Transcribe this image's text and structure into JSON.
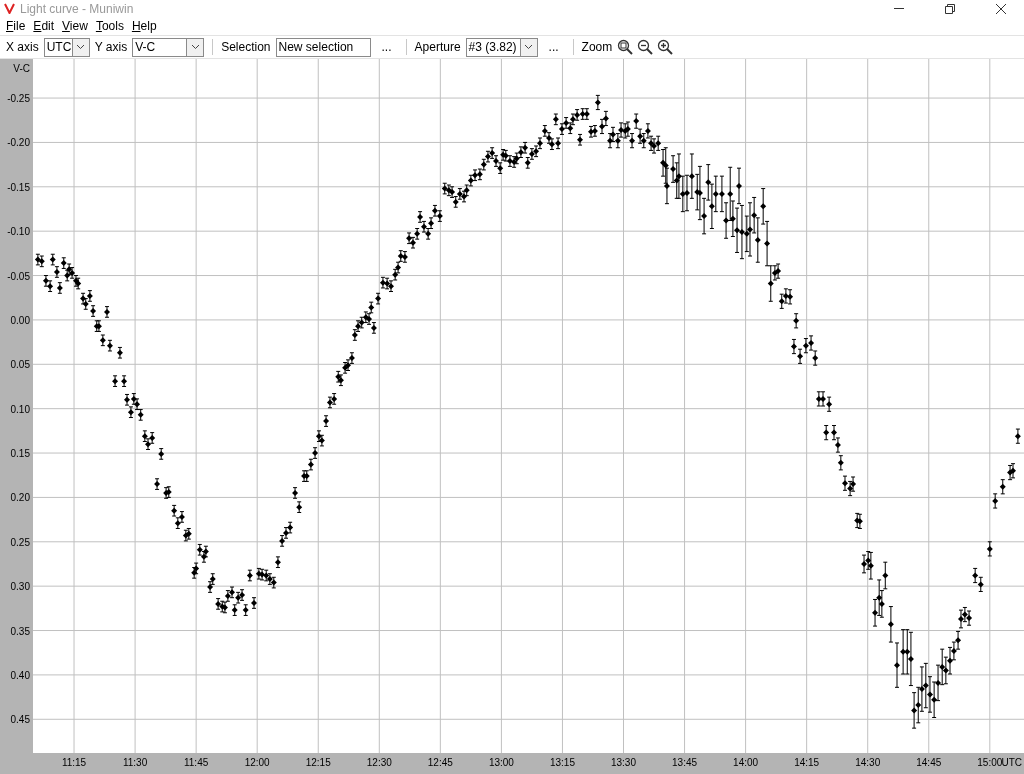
{
  "window": {
    "title": "Light curve - Muniwin"
  },
  "menu": [
    "File",
    "Edit",
    "View",
    "Tools",
    "Help"
  ],
  "toolbar": [
    {
      "kind": "label",
      "text": "X axis"
    },
    {
      "kind": "combo",
      "value": "UTC"
    },
    {
      "kind": "label",
      "text": "Y axis"
    },
    {
      "kind": "combo",
      "value": "V-C"
    },
    {
      "kind": "separator"
    },
    {
      "kind": "label",
      "text": "Selection"
    },
    {
      "kind": "field",
      "value": "New selection"
    },
    {
      "kind": "button",
      "text": "..."
    },
    {
      "kind": "separator"
    },
    {
      "kind": "label",
      "text": "Aperture"
    },
    {
      "kind": "combo",
      "value": "#3 (3.82)"
    },
    {
      "kind": "button",
      "text": "..."
    },
    {
      "kind": "separator"
    },
    {
      "kind": "label",
      "text": "Zoom"
    },
    {
      "kind": "zoom_icons"
    }
  ],
  "chart": {
    "chart_data": {
      "type": "scatter",
      "xlabel": "UTC",
      "ylabel": "V-C",
      "grid": true,
      "xlim": [
        11.082,
        15.14
      ],
      "ylim": [
        0.488,
        -0.294
      ],
      "xticks": [
        {
          "value": 11.25,
          "label": "11:15"
        },
        {
          "value": 11.5,
          "label": "11:30"
        },
        {
          "value": 11.75,
          "label": "11:45"
        },
        {
          "value": 12,
          "label": "12:00"
        },
        {
          "value": 12.25,
          "label": "12:15"
        },
        {
          "value": 12.5,
          "label": "12:30"
        },
        {
          "value": 12.75,
          "label": "12:45"
        },
        {
          "value": 13,
          "label": "13:00"
        },
        {
          "value": 13.25,
          "label": "13:15"
        },
        {
          "value": 13.5,
          "label": "13:30"
        },
        {
          "value": 13.75,
          "label": "13:45"
        },
        {
          "value": 14,
          "label": "14:00"
        },
        {
          "value": 14.25,
          "label": "14:15"
        },
        {
          "value": 14.5,
          "label": "14:30"
        },
        {
          "value": 14.75,
          "label": "14:45"
        },
        {
          "value": 15,
          "label": "15:00"
        }
      ],
      "yticks": [
        {
          "value": -0.25,
          "label": "-0.25"
        },
        {
          "value": -0.2,
          "label": "-0.20"
        },
        {
          "value": -0.15,
          "label": "-0.15"
        },
        {
          "value": -0.1,
          "label": "-0.10"
        },
        {
          "value": -0.05,
          "label": "-0.05"
        },
        {
          "value": 0,
          "label": "0.00"
        },
        {
          "value": 0.05,
          "label": "0.05"
        },
        {
          "value": 0.1,
          "label": "0.10"
        },
        {
          "value": 0.15,
          "label": "0.15"
        },
        {
          "value": 0.2,
          "label": "0.20"
        },
        {
          "value": 0.25,
          "label": "0.25"
        },
        {
          "value": 0.3,
          "label": "0.30"
        },
        {
          "value": 0.35,
          "label": "0.35"
        },
        {
          "value": 0.4,
          "label": "0.40"
        },
        {
          "value": 0.45,
          "label": "0.45"
        }
      ],
      "x": [
        11.102,
        11.118,
        11.135,
        11.152,
        11.163,
        11.18,
        11.192,
        11.208,
        11.222,
        11.23,
        11.242,
        11.258,
        11.267,
        11.287,
        11.298,
        11.315,
        11.328,
        11.343,
        11.352,
        11.368,
        11.385,
        11.397,
        11.418,
        11.438,
        11.455,
        11.467,
        11.483,
        11.495,
        11.508,
        11.523,
        11.54,
        11.553,
        11.57,
        11.59,
        11.607,
        11.627,
        11.638,
        11.66,
        11.675,
        11.692,
        11.708,
        11.72,
        11.742,
        11.75,
        11.765,
        11.782,
        11.79,
        11.807,
        11.818,
        11.84,
        11.857,
        11.868,
        11.88,
        11.897,
        11.908,
        11.922,
        11.938,
        11.953,
        11.97,
        11.987,
        12.007,
        12.02,
        12.037,
        12.052,
        12.068,
        12.085,
        12.102,
        12.118,
        12.135,
        12.155,
        12.172,
        12.192,
        12.203,
        12.22,
        12.237,
        12.253,
        12.265,
        12.282,
        12.298,
        12.315,
        12.332,
        12.343,
        12.36,
        12.372,
        12.388,
        12.4,
        12.413,
        12.428,
        12.445,
        12.458,
        12.467,
        12.478,
        12.495,
        12.515,
        12.532,
        12.548,
        12.565,
        12.577,
        12.588,
        12.605,
        12.622,
        12.638,
        12.655,
        12.667,
        12.683,
        12.7,
        12.712,
        12.728,
        12.748,
        12.768,
        12.785,
        12.798,
        12.813,
        12.83,
        12.847,
        12.858,
        12.875,
        12.892,
        12.912,
        12.928,
        12.945,
        12.962,
        12.978,
        12.995,
        13.007,
        13.018,
        13.035,
        13.052,
        13.063,
        13.08,
        13.097,
        13.108,
        13.125,
        13.142,
        13.158,
        13.178,
        13.195,
        13.207,
        13.223,
        13.232,
        13.248,
        13.265,
        13.282,
        13.293,
        13.31,
        13.322,
        13.333,
        13.35,
        13.367,
        13.383,
        13.395,
        13.412,
        13.428,
        13.445,
        13.457,
        13.477,
        13.49,
        13.507,
        13.518,
        13.535,
        13.552,
        13.568,
        13.583,
        13.6,
        13.613,
        13.625,
        13.642,
        13.662,
        13.673,
        13.678,
        13.703,
        13.718,
        13.727,
        13.743,
        13.76,
        13.78,
        13.802,
        13.813,
        13.83,
        13.847,
        13.862,
        13.878,
        13.903,
        13.92,
        13.937,
        13.948,
        13.965,
        13.973,
        13.985,
        14.005,
        14.018,
        14.035,
        14.05,
        14.072,
        14.088,
        14.103,
        14.12,
        14.133,
        14.148,
        14.165,
        14.182,
        14.207,
        14.198,
        14.223,
        14.247,
        14.268,
        14.285,
        14.3,
        14.317,
        14.342,
        14.33,
        14.362,
        14.378,
        14.39,
        14.407,
        14.428,
        14.44,
        14.457,
        14.468,
        14.485,
        14.502,
        14.513,
        14.53,
        14.547,
        14.558,
        14.572,
        14.595,
        14.62,
        14.645,
        14.662,
        14.677,
        14.69,
        14.707,
        14.722,
        14.738,
        14.755,
        14.772,
        14.788,
        14.805,
        14.82,
        14.837,
        14.853,
        14.87,
        14.882,
        14.898,
        14.915,
        14.94,
        14.963,
        15.0,
        15.022,
        15.053,
        15.083,
        15.095,
        15.115
      ],
      "series": [
        {
          "color": "#000000",
          "errors": [
            0.006,
            0.006,
            0.006,
            0.006,
            0.006,
            0.006,
            0.006,
            0.006,
            0.006,
            0.006,
            0.006,
            0.006,
            0.006,
            0.006,
            0.006,
            0.006,
            0.006,
            0.006,
            0.006,
            0.006,
            0.006,
            0.006,
            0.006,
            0.006,
            0.006,
            0.006,
            0.006,
            0.006,
            0.006,
            0.006,
            0.006,
            0.006,
            0.006,
            0.006,
            0.006,
            0.006,
            0.006,
            0.006,
            0.006,
            0.006,
            0.006,
            0.006,
            0.006,
            0.006,
            0.006,
            0.006,
            0.006,
            0.006,
            0.006,
            0.006,
            0.006,
            0.006,
            0.006,
            0.006,
            0.006,
            0.006,
            0.006,
            0.006,
            0.006,
            0.006,
            0.006,
            0.006,
            0.006,
            0.006,
            0.006,
            0.006,
            0.006,
            0.006,
            0.006,
            0.006,
            0.006,
            0.006,
            0.006,
            0.006,
            0.006,
            0.006,
            0.006,
            0.006,
            0.006,
            0.006,
            0.006,
            0.006,
            0.006,
            0.006,
            0.006,
            0.006,
            0.006,
            0.006,
            0.006,
            0.006,
            0.006,
            0.006,
            0.006,
            0.006,
            0.006,
            0.006,
            0.006,
            0.006,
            0.006,
            0.006,
            0.006,
            0.006,
            0.006,
            0.006,
            0.006,
            0.006,
            0.006,
            0.006,
            0.006,
            0.006,
            0.006,
            0.006,
            0.006,
            0.006,
            0.006,
            0.006,
            0.006,
            0.006,
            0.006,
            0.006,
            0.006,
            0.006,
            0.006,
            0.006,
            0.006,
            0.006,
            0.006,
            0.006,
            0.006,
            0.006,
            0.006,
            0.006,
            0.006,
            0.006,
            0.006,
            0.006,
            0.006,
            0.006,
            0.006,
            0.006,
            0.006,
            0.006,
            0.006,
            0.006,
            0.006,
            0.006,
            0.006,
            0.006,
            0.006,
            0.006,
            0.008,
            0.008,
            0.008,
            0.008,
            0.008,
            0.008,
            0.008,
            0.008,
            0.008,
            0.008,
            0.008,
            0.008,
            0.008,
            0.008,
            0.008,
            0.008,
            0.008,
            0.015,
            0.02,
            0.02,
            0.015,
            0.02,
            0.025,
            0.02,
            0.02,
            0.025,
            0.02,
            0.03,
            0.02,
            0.02,
            0.025,
            0.02,
            0.02,
            0.02,
            0.03,
            0.02,
            0.025,
            0.02,
            0.03,
            0.02,
            0.03,
            0.02,
            0.025,
            0.02,
            0.025,
            0.02,
            0.008,
            0.008,
            0.008,
            0.008,
            0.008,
            0.008,
            0.008,
            0.008,
            0.008,
            0.008,
            0.008,
            0.008,
            0.008,
            0.008,
            0.008,
            0.008,
            0.008,
            0.008,
            0.008,
            0.008,
            0.008,
            0.008,
            0.008,
            0.01,
            0.01,
            0.015,
            0.015,
            0.02,
            0.015,
            0.015,
            0.02,
            0.025,
            0.025,
            0.025,
            0.03,
            0.02,
            0.02,
            0.025,
            0.025,
            0.02,
            0.02,
            0.02,
            0.02,
            0.015,
            0.015,
            0.01,
            0.01,
            0.01,
            0.008,
            0.008,
            0.008,
            0.008,
            0.008,
            0.008,
            0.008,
            0.008,
            0.008,
            0.008
          ],
          "values": [
            -0.068,
            -0.066,
            -0.044,
            -0.038,
            -0.068,
            -0.054,
            -0.036,
            -0.064,
            -0.05,
            -0.057,
            -0.053,
            -0.044,
            -0.041,
            -0.024,
            -0.018,
            -0.027,
            -0.01,
            0.007,
            0.007,
            0.023,
            -0.009,
            0.029,
            0.069,
            0.037,
            0.069,
            0.09,
            0.104,
            0.089,
            0.095,
            0.107,
            0.131,
            0.14,
            0.133,
            0.185,
            0.151,
            0.195,
            0.194,
            0.215,
            0.229,
            0.222,
            0.243,
            0.241,
            0.285,
            0.28,
            0.259,
            0.267,
            0.261,
            0.301,
            0.292,
            0.32,
            0.323,
            0.324,
            0.311,
            0.307,
            0.327,
            0.313,
            0.31,
            0.327,
            0.288,
            0.319,
            0.286,
            0.287,
            0.288,
            0.292,
            0.296,
            0.273,
            0.249,
            0.24,
            0.234,
            0.195,
            0.211,
            0.176,
            0.176,
            0.163,
            0.15,
            0.131,
            0.136,
            0.114,
            0.093,
            0.089,
            0.064,
            0.068,
            0.054,
            0.051,
            0.043,
            0.017,
            0.007,
            0.003,
            -0.003,
            -0.001,
            -0.014,
            0.009,
            -0.024,
            -0.042,
            -0.041,
            -0.038,
            -0.051,
            -0.059,
            -0.072,
            -0.071,
            -0.092,
            -0.087,
            -0.097,
            -0.116,
            -0.105,
            -0.097,
            -0.109,
            -0.123,
            -0.117,
            -0.148,
            -0.146,
            -0.144,
            -0.133,
            -0.142,
            -0.139,
            -0.146,
            -0.157,
            -0.163,
            -0.164,
            -0.175,
            -0.184,
            -0.188,
            -0.179,
            -0.171,
            -0.186,
            -0.185,
            -0.179,
            -0.178,
            -0.182,
            -0.189,
            -0.194,
            -0.177,
            -0.187,
            -0.19,
            -0.199,
            -0.213,
            -0.205,
            -0.198,
            -0.226,
            -0.199,
            -0.215,
            -0.222,
            -0.216,
            -0.226,
            -0.231,
            -0.203,
            -0.232,
            -0.232,
            -0.212,
            -0.213,
            -0.245,
            -0.218,
            -0.227,
            -0.202,
            -0.209,
            -0.202,
            -0.214,
            -0.213,
            -0.215,
            -0.202,
            -0.224,
            -0.207,
            -0.202,
            -0.213,
            -0.199,
            -0.196,
            -0.199,
            -0.177,
            -0.174,
            -0.151,
            -0.17,
            -0.157,
            -0.162,
            -0.142,
            -0.143,
            -0.162,
            -0.144,
            -0.143,
            -0.117,
            -0.155,
            -0.128,
            -0.142,
            -0.142,
            -0.112,
            -0.142,
            -0.114,
            -0.101,
            -0.151,
            -0.099,
            -0.097,
            -0.102,
            -0.118,
            -0.09,
            -0.128,
            -0.086,
            -0.041,
            -0.053,
            -0.055,
            -0.021,
            -0.027,
            -0.026,
            0.001,
            0.03,
            0.041,
            0.029,
            0.026,
            0.043,
            0.089,
            0.089,
            0.095,
            0.127,
            0.127,
            0.141,
            0.161,
            0.184,
            0.19,
            0.185,
            0.226,
            0.227,
            0.275,
            0.271,
            0.277,
            0.33,
            0.313,
            0.32,
            0.288,
            0.343,
            0.389,
            0.374,
            0.374,
            0.382,
            0.44,
            0.434,
            0.416,
            0.412,
            0.422,
            0.428,
            0.409,
            0.391,
            0.395,
            0.384,
            0.373,
            0.361,
            0.337,
            0.332,
            0.336,
            0.288,
            0.298,
            0.258,
            0.204,
            0.188,
            0.172,
            0.17,
            0.131
          ]
        }
      ]
    }
  }
}
